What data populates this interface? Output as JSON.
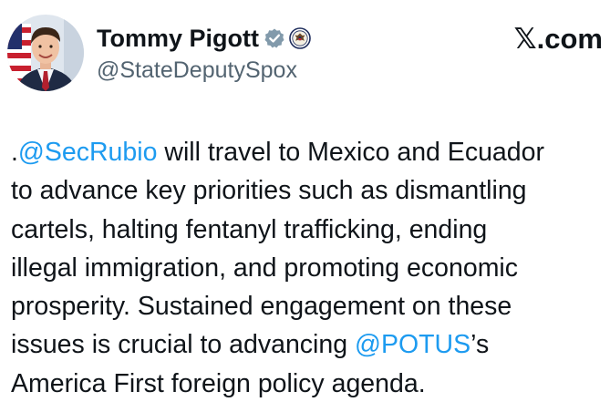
{
  "author": {
    "display_name": "Tommy Pigott",
    "handle": "@StateDeputySpox",
    "verified_badge_color": "#829aab"
  },
  "brand": {
    "x_logo": "𝕏",
    "domain": ".com"
  },
  "tweet": {
    "line1": {
      "prefix": ".",
      "mention": "@SecRubio",
      "rest": " will travel to Mexico and Ecuador"
    },
    "line2": "to advance key priorities such as dismantling",
    "line3": "cartels, halting fentanyl trafficking, ending",
    "line4": "illegal immigration, and promoting economic",
    "line5": "prosperity.  Sustained engagement on these",
    "line6": {
      "text": "issues is crucial to advancing ",
      "mention": "@POTUS",
      "suffix": "’s"
    },
    "line7": "America First foreign policy agenda."
  },
  "colors": {
    "mention": "#1d9bf0",
    "text": "#0f1419",
    "secondary": "#536471"
  },
  "icons": {
    "verified": "verified-badge-icon",
    "affiliation": "state-department-seal-icon",
    "brand": "x-logo-icon"
  }
}
